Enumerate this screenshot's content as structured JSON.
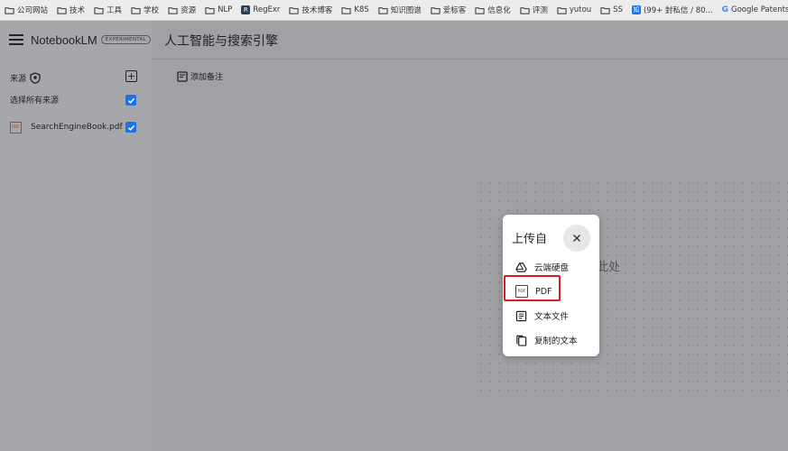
{
  "bookmarks": [
    {
      "label": "公司网站",
      "icon": "folder-icon"
    },
    {
      "label": "技术",
      "icon": "folder-icon"
    },
    {
      "label": "工具",
      "icon": "folder-icon"
    },
    {
      "label": "学校",
      "icon": "folder-icon"
    },
    {
      "label": "资源",
      "icon": "folder-icon"
    },
    {
      "label": "NLP",
      "icon": "folder-icon"
    },
    {
      "label": "RegExr",
      "icon": "regexr-icon"
    },
    {
      "label": "技术博客",
      "icon": "folder-icon"
    },
    {
      "label": "K8S",
      "icon": "folder-icon"
    },
    {
      "label": "知识图谱",
      "icon": "folder-icon"
    },
    {
      "label": "爱标客",
      "icon": "folder-icon"
    },
    {
      "label": "信息化",
      "icon": "folder-icon"
    },
    {
      "label": "评测",
      "icon": "folder-icon"
    },
    {
      "label": "yutou",
      "icon": "folder-icon"
    },
    {
      "label": "SS",
      "icon": "folder-icon"
    },
    {
      "label": "(99+ 封私信 / 80...",
      "icon": "zhihu-icon"
    },
    {
      "label": "Google Patents",
      "icon": "google-icon"
    }
  ],
  "app": {
    "title": "NotebookLM",
    "badge": "EXPERIMENTAL"
  },
  "sidebar": {
    "sources_label": "来源",
    "select_all_label": "选择所有来源",
    "file_name": "SearchEngineBook.pdf",
    "pdf_tag": "PDF"
  },
  "main": {
    "title": "人工智能与搜索引擎",
    "add_note_label": "添加备注",
    "empty_text": "保存备注将显示在此处"
  },
  "upload_popup": {
    "title": "上传自",
    "options": [
      "云端硬盘",
      "PDF",
      "文本文件",
      "复制的文本"
    ],
    "pdf_tag": "PDF"
  },
  "colors": {
    "checkbox": "#1a73e8",
    "highlight": "#d62020",
    "pdf_icon": "#d93025"
  }
}
